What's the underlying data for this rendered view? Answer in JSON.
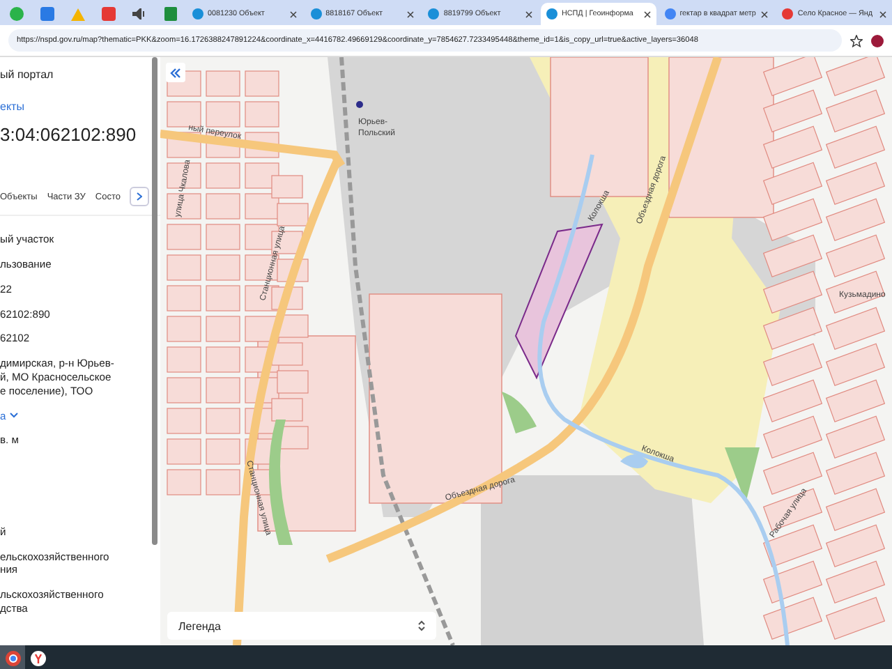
{
  "browser": {
    "tabs": [
      {
        "title": "0081230 Объект",
        "selected": false
      },
      {
        "title": "8818167 Объект",
        "selected": false
      },
      {
        "title": "8819799 Объект",
        "selected": false
      },
      {
        "title": "НСПД | Геоинформа",
        "selected": true
      },
      {
        "title": "гектар в квадрат метр",
        "selected": false
      },
      {
        "title": "Село Красное — Янд",
        "selected": false
      }
    ],
    "url": "https://nspd.gov.ru/map?thematic=PKK&zoom=16.1726388247891224&coordinate_x=4416782.49669129&coordinate_y=7854627.7233495448&theme_id=1&is_copy_url=true&active_layers=36048"
  },
  "panel": {
    "portal_title": "ый портал",
    "link": "екты",
    "cadastral_number": "3:04:062102:890",
    "tabs": [
      {
        "label": "Объекты"
      },
      {
        "label": "Части ЗУ"
      },
      {
        "label": "Состо"
      }
    ],
    "lines": [
      {
        "kind": "text",
        "text": "ый участок"
      },
      {
        "kind": "text",
        "text": "льзование"
      },
      {
        "kind": "text",
        "text": "22"
      },
      {
        "kind": "text",
        "text": "62102:890"
      },
      {
        "kind": "text",
        "text": "62102"
      },
      {
        "kind": "text",
        "text": "димирская, р-н Юрьев-\nй, МО Красносельское\nе поселение), ТОО"
      },
      {
        "kind": "dropdown",
        "text": "а"
      },
      {
        "kind": "text",
        "text": "в. м"
      },
      {
        "kind": "gap"
      },
      {
        "kind": "text",
        "text": "й"
      },
      {
        "kind": "text",
        "text": "ельскохозяйственного\nния"
      },
      {
        "kind": "text",
        "text": "льскохозяйственного\nдства"
      }
    ]
  },
  "map": {
    "labels": [
      {
        "text": "Юрьев-"
      },
      {
        "text": "Польский"
      },
      {
        "text": "ный переулок"
      },
      {
        "text": "улица Чкалова"
      },
      {
        "text": "Станционная улица"
      },
      {
        "text": "Станционная улица"
      },
      {
        "text": "Объездная дорога"
      },
      {
        "text": "Объездная дорога"
      },
      {
        "text": "Колокша"
      },
      {
        "text": "Колокша"
      },
      {
        "text": "Кузьмадино"
      },
      {
        "text": "Рабочая улица"
      }
    ],
    "legend": "Легенда"
  }
}
